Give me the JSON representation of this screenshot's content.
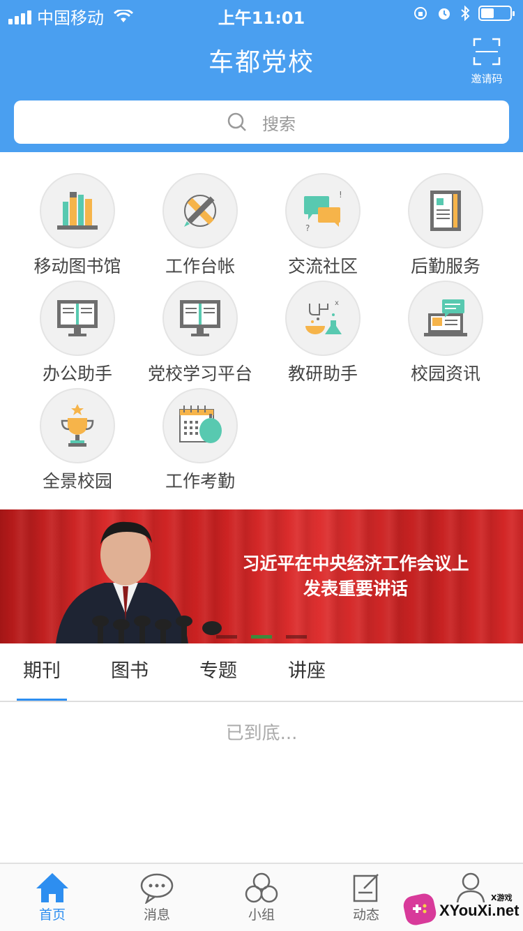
{
  "status_bar": {
    "carrier": "中国移动",
    "time": "上午11:01"
  },
  "header": {
    "title": "车都党校",
    "invite_label": "邀请码"
  },
  "search": {
    "placeholder": "搜索"
  },
  "grid": {
    "items": [
      {
        "label": "移动图书馆",
        "icon": "library-books-icon"
      },
      {
        "label": "工作台帐",
        "icon": "pencil-ruler-icon"
      },
      {
        "label": "交流社区",
        "icon": "chat-bubbles-icon"
      },
      {
        "label": "后勤服务",
        "icon": "notebook-icon"
      },
      {
        "label": "办公助手",
        "icon": "monitor-book-icon"
      },
      {
        "label": "党校学习平台",
        "icon": "monitor-book-icon"
      },
      {
        "label": "教研助手",
        "icon": "lab-flasks-icon"
      },
      {
        "label": "校园资讯",
        "icon": "laptop-news-icon"
      },
      {
        "label": "全景校园",
        "icon": "trophy-icon"
      },
      {
        "label": "工作考勤",
        "icon": "calendar-clock-icon"
      }
    ]
  },
  "banner": {
    "line1": "习近平在中央经济工作会议上",
    "line2": "发表重要讲话"
  },
  "tabs": [
    {
      "label": "期刊",
      "active": true
    },
    {
      "label": "图书",
      "active": false
    },
    {
      "label": "专题",
      "active": false
    },
    {
      "label": "讲座",
      "active": false
    }
  ],
  "list_end_text": "已到底...",
  "tabbar": [
    {
      "label": "首页",
      "icon": "home-icon",
      "active": true
    },
    {
      "label": "消息",
      "icon": "message-icon",
      "active": false
    },
    {
      "label": "小组",
      "icon": "group-icon",
      "active": false
    },
    {
      "label": "动态",
      "icon": "edit-icon",
      "active": false
    }
  ],
  "watermark": {
    "text": "XYouXi.net",
    "small": "X游戏"
  },
  "colors": {
    "header_blue": "#4a9ff0",
    "active_blue": "#2d8ef0",
    "banner_red": "#d82a2a"
  }
}
